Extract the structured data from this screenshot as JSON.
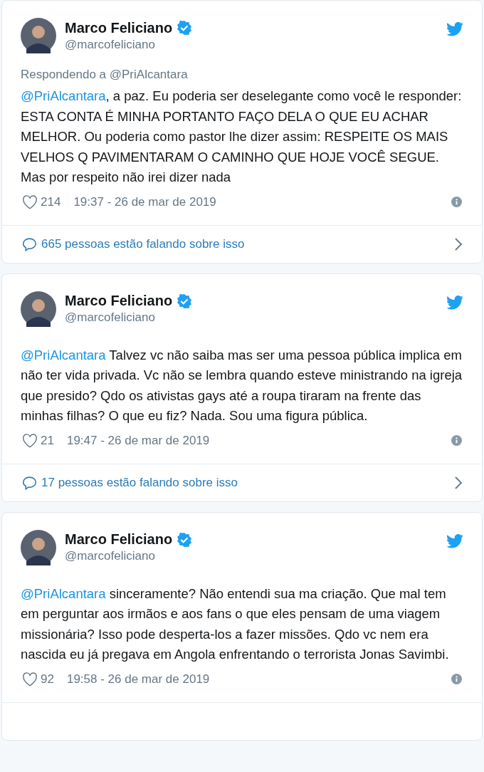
{
  "tweets": [
    {
      "name": "Marco Feliciano",
      "handle": "@marcofeliciano",
      "verified": true,
      "reply_to": "Respondendo a @PriAlcantara",
      "mention": "@PriAlcantara",
      "text": ", a paz. Eu poderia ser deselegante como você le responder: ESTA CONTA É MINHA PORTANTO FAÇO DELA O QUE EU ACHAR MELHOR. Ou poderia como pastor lhe dizer assim: RESPEITE OS MAIS VELHOS Q PAVIMENTARAM O CAMINHO QUE HOJE VOCÊ SEGUE. Mas por respeito não irei dizer nada",
      "likes": "214",
      "time": "19:37 - 26 de mar de 2019",
      "conversation": "665 pessoas estão falando sobre isso"
    },
    {
      "name": "Marco Feliciano",
      "handle": "@marcofeliciano",
      "verified": true,
      "mention": "@PriAlcantara",
      "text": " Talvez vc não saiba mas ser uma pessoa pública implica em não ter vida privada. Vc não se lembra quando esteve ministrando na igreja que presido? Qdo os ativistas gays até a roupa tiraram na frente das minhas filhas? O que eu fiz? Nada. Sou uma figura pública.",
      "likes": "21",
      "time": "19:47 - 26 de mar de 2019",
      "conversation": "17 pessoas estão falando sobre isso"
    },
    {
      "name": "Marco Feliciano",
      "handle": "@marcofeliciano",
      "verified": true,
      "mention": "@PriAlcantara",
      "text": " sinceramente? Não entendi sua ma criação. Que mal tem em perguntar aos irmãos e aos fans o que eles pensam de uma viagem missionária? Isso pode desperta-los a fazer missões. Qdo vc nem era nascida eu já pregava em Angola enfrentando o terrorista Jonas Savimbi.",
      "likes": "92",
      "time": "19:58 - 26 de mar de 2019"
    }
  ]
}
